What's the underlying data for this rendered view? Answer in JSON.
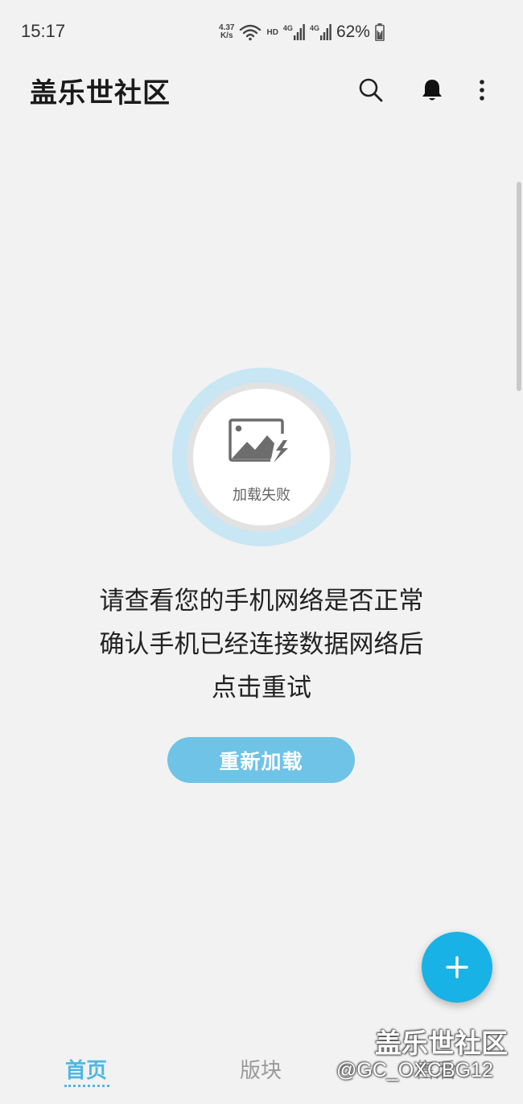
{
  "status_bar": {
    "time": "15:17",
    "net_speed_value": "4.37",
    "net_speed_unit": "K/s",
    "hd_label": "HD",
    "network_type_1": "4G",
    "network_type_2": "4G",
    "battery_percent": "62%",
    "icons": [
      "wifi-icon",
      "signal-icon",
      "battery-charging-icon"
    ]
  },
  "app_bar": {
    "title": "盖乐世社区",
    "icons": [
      "search-icon",
      "bell-icon",
      "more-vertical-icon"
    ]
  },
  "error": {
    "icon": "broken-image-icon",
    "label": "加载失败",
    "message_lines": [
      "请查看您的手机网络是否正常",
      "确认手机已经连接数据网络后",
      "点击重试"
    ],
    "reload_label": "重新加载"
  },
  "fab": {
    "icon": "plus-icon"
  },
  "bottom_nav": {
    "items": [
      {
        "label": "首页",
        "active": true
      },
      {
        "label": "版块",
        "active": false
      },
      {
        "label": "售后",
        "active": false
      }
    ]
  },
  "watermark": {
    "title": "盖乐世社区",
    "user": "@GC_OXCBG12"
  },
  "colors": {
    "background": "#f2f2f2",
    "accent": "#4fb7e3",
    "reload_button": "#6ec3e6",
    "fab": "#18b2e6"
  }
}
